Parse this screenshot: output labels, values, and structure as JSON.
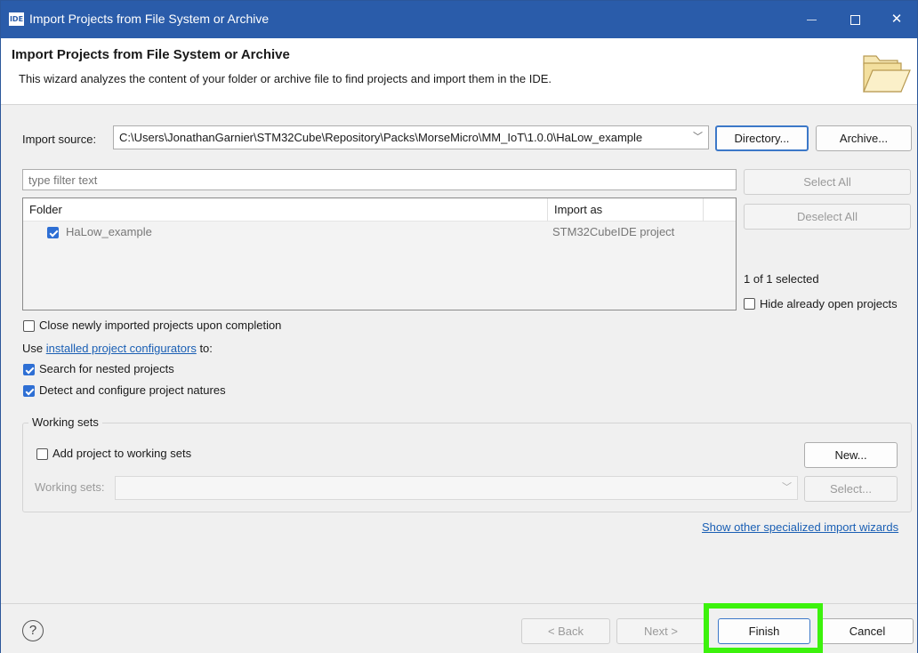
{
  "window": {
    "app_icon_text": "IDE",
    "title": "Import Projects from File System or Archive",
    "controls": [
      "minimize",
      "maximize",
      "close"
    ]
  },
  "header": {
    "title": "Import Projects from File System or Archive",
    "description": "This wizard analyzes the content of your folder or archive file to find projects and import them in the IDE.",
    "icon": "folder-open-icon"
  },
  "import_source": {
    "label": "Import source:",
    "value": "C:\\Users\\JonathanGarnier\\STM32Cube\\Repository\\Packs\\MorseMicro\\MM_IoT\\1.0.0\\HaLow_example",
    "directory_button": "Directory...",
    "archive_button": "Archive..."
  },
  "filter": {
    "placeholder": "type filter text"
  },
  "buttons": {
    "select_all": "Select All",
    "deselect_all": "Deselect All"
  },
  "table": {
    "columns": [
      "Folder",
      "Import as"
    ],
    "rows": [
      {
        "folder": "HaLow_example",
        "import_as": "STM32CubeIDE project",
        "checked": true
      }
    ]
  },
  "selection_status": "1 of 1 selected",
  "hide_open_projects": {
    "label": "Hide already open projects",
    "checked": false
  },
  "close_projects": {
    "label": "Close newly imported projects upon completion",
    "checked": false
  },
  "configurators": {
    "prefix": "Use ",
    "link": "installed project configurators",
    "suffix": " to:"
  },
  "search_nested": {
    "label": "Search for nested projects",
    "checked": true
  },
  "detect_natures": {
    "label": "Detect and configure project natures",
    "checked": true
  },
  "working_sets": {
    "group_title": "Working sets",
    "add_label": "Add project to working sets",
    "add_checked": false,
    "new_button": "New...",
    "sets_label": "Working sets:",
    "select_button": "Select..."
  },
  "other_wizards_link": "Show other specialized import wizards",
  "footer": {
    "help_icon": "?",
    "back": "< Back",
    "next": "Next >",
    "finish": "Finish",
    "cancel": "Cancel"
  },
  "colors": {
    "titlebar": "#2a5caa",
    "highlight": "#3cf20c",
    "checkbox": "#2e6fd4",
    "link": "#1a5fb4"
  }
}
